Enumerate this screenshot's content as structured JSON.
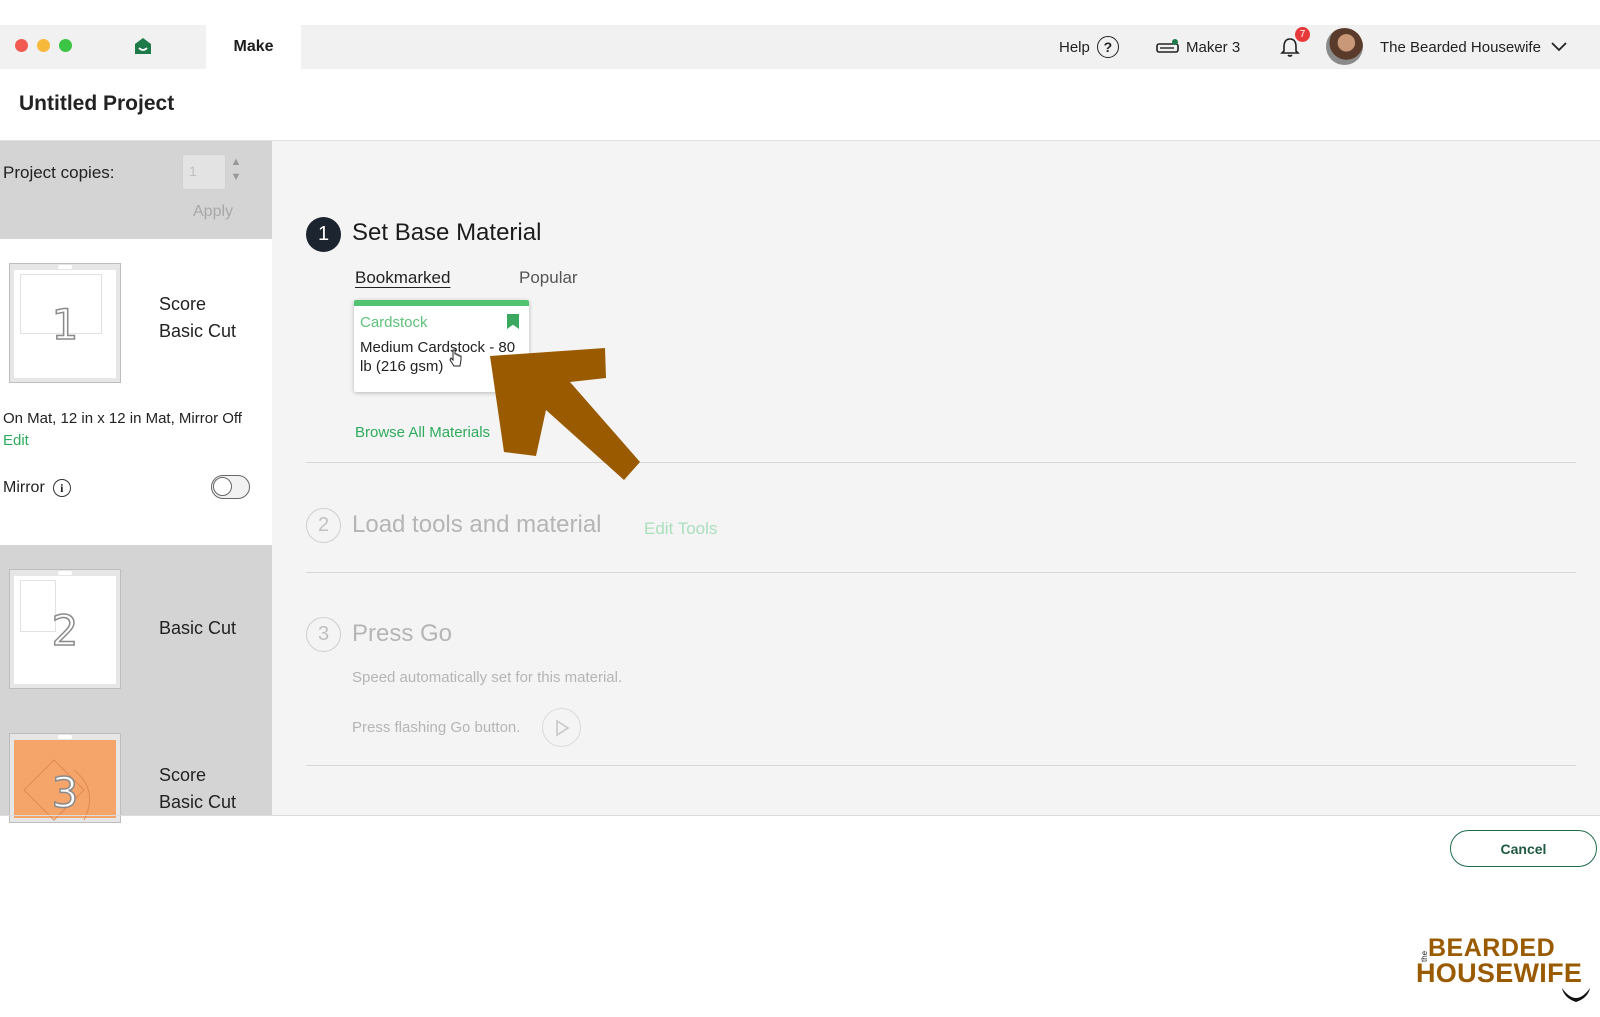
{
  "titlebar": {
    "make_tab": "Make",
    "help_label": "Help",
    "help_symbol": "?",
    "machine": "Maker 3",
    "notification_count": "7",
    "user_name": "The Bearded Housewife"
  },
  "header": {
    "title": "Untitled Project"
  },
  "sidebar": {
    "copies_label": "Project copies:",
    "copies_value": "1",
    "apply_label": "Apply",
    "mats": [
      {
        "number": "1",
        "line1": "Score",
        "line2": "Basic Cut"
      },
      {
        "number": "2",
        "line1": "Basic Cut",
        "line2": ""
      },
      {
        "number": "3",
        "line1": "Score",
        "line2": "Basic Cut"
      }
    ],
    "mat_info": "On Mat, 12 in x 12 in Mat, Mirror Off",
    "edit_label": "Edit",
    "mirror_label": "Mirror",
    "mirror_on": false
  },
  "steps": [
    {
      "number": "1",
      "title": "Set Base Material"
    },
    {
      "number": "2",
      "title": "Load tools and material",
      "link": "Edit Tools"
    },
    {
      "number": "3",
      "title": "Press Go",
      "speed_note": "Speed automatically set for this material.",
      "go_note": "Press flashing Go button."
    }
  ],
  "material_tabs": [
    "Bookmarked",
    "Popular"
  ],
  "material_card": {
    "category": "Cardstock",
    "name": "Medium Cardstock - 80 lb (216 gsm)"
  },
  "browse_link": "Browse All Materials",
  "footer": {
    "cancel_label": "Cancel"
  },
  "watermark": {
    "prefix": "the",
    "line1": "BEARDED",
    "line2": "HOUSEWIFE"
  },
  "colors": {
    "accent_green": "#2eab5c",
    "arrow_brown": "#9a5b00",
    "step_active": "#1c2430",
    "notification_red": "#e8393a"
  }
}
